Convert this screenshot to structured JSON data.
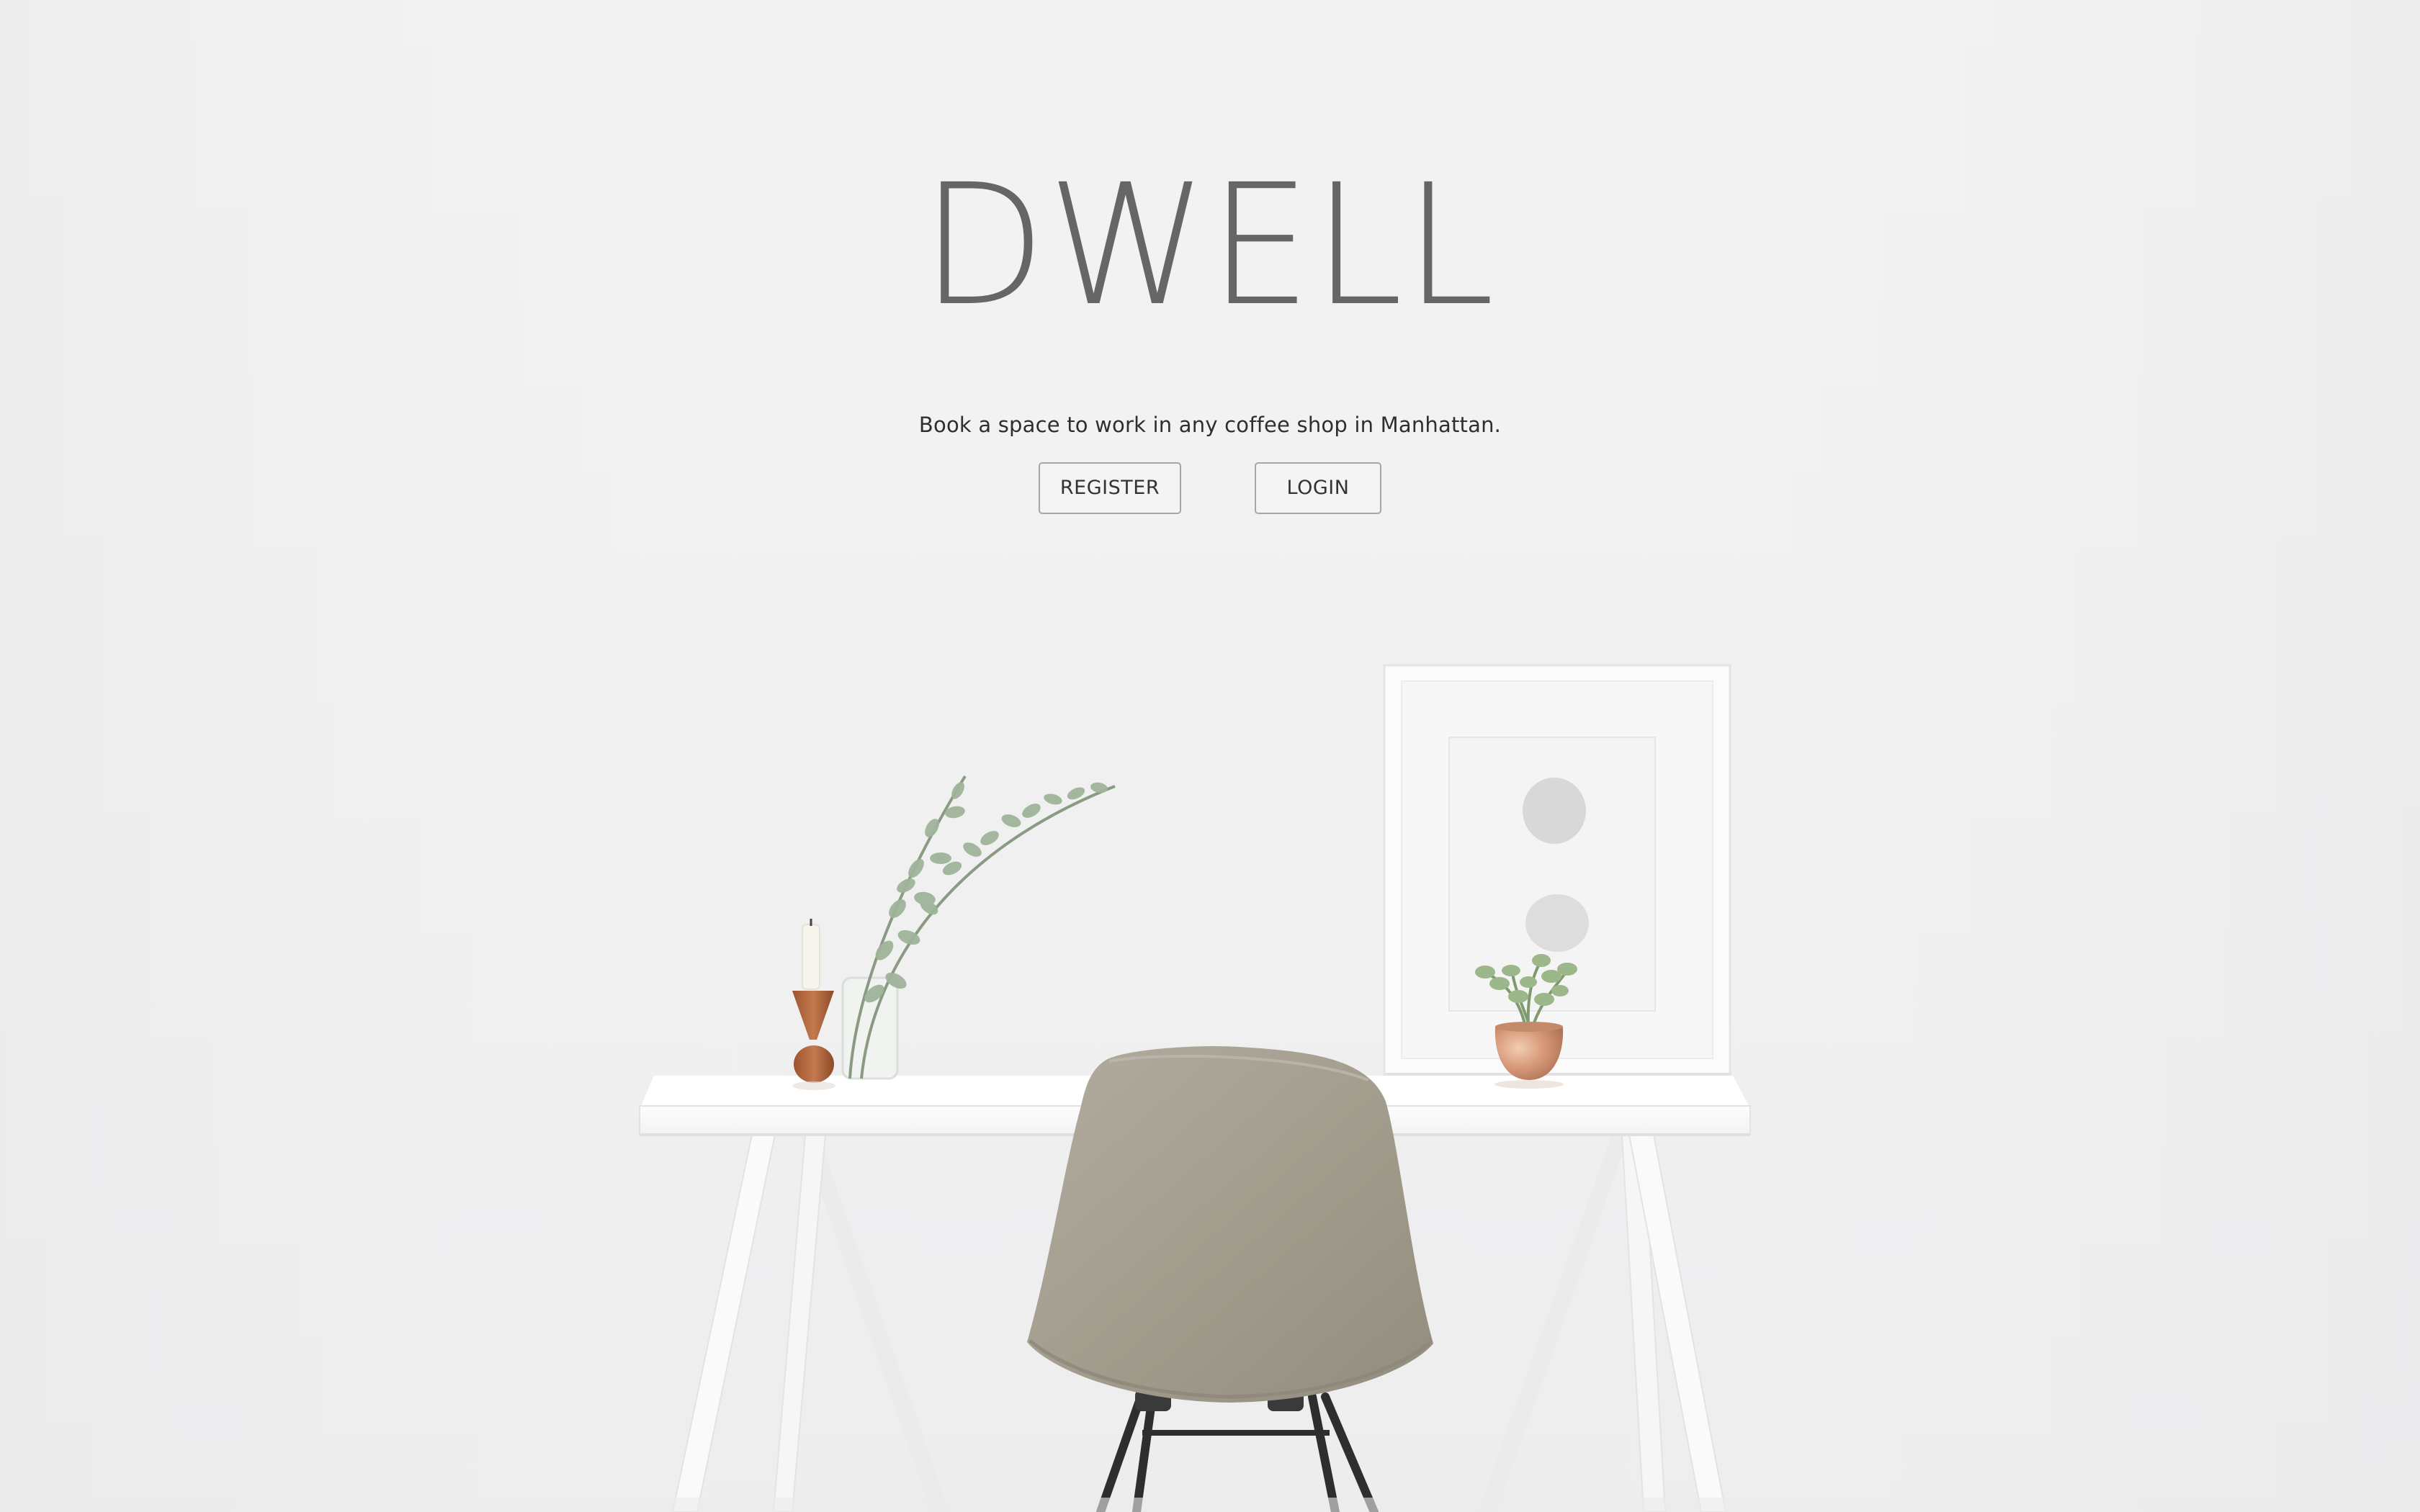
{
  "hero": {
    "logo": "DWELL",
    "tagline": "Book a space to work in any coffee shop in Manhattan.",
    "register_label": "REGISTER",
    "login_label": "LOGIN"
  },
  "colors": {
    "background": "#f1f1f1",
    "logo_text": "#666666",
    "tagline_text": "#2f2f2f",
    "button_border": "#a6a6a6",
    "chair": "#a49e8f",
    "desk": "#fbfbfb",
    "copper": "#d49b7b"
  },
  "background_photo": {
    "subject": "desk-chair-plants-frame-scene"
  }
}
